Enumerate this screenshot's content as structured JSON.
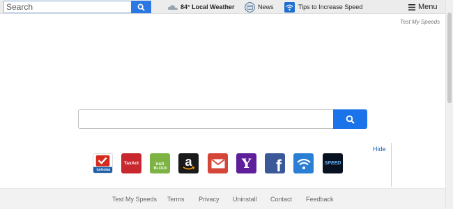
{
  "toolbar": {
    "search_placeholder": "Search",
    "weather_label": "84° Local Weather",
    "news_label": "News",
    "tips_label": "Tips to Increase Speed",
    "menu_label": "Menu"
  },
  "brand": "Test My Speeds",
  "shortcuts": {
    "hide_label": "Hide",
    "tiles": [
      {
        "icon": "turbotax-icon",
        "label": "turbotax",
        "color": "#1a60a8"
      },
      {
        "icon": "taxact-icon",
        "label": "TaxAct",
        "color": "#c8282d"
      },
      {
        "icon": "hr-block-icon",
        "label": "H&R BLOCK",
        "color": "#7cb342"
      },
      {
        "icon": "amazon-icon",
        "label": "a",
        "color": "#1a1a1a"
      },
      {
        "icon": "gmail-icon",
        "label": "",
        "color": "#d44638"
      },
      {
        "icon": "yahoo-icon",
        "label": "Y",
        "color": "#5f1f9a"
      },
      {
        "icon": "facebook-icon",
        "label": "f",
        "color": "#3b5998"
      },
      {
        "icon": "wifi-icon",
        "label": "",
        "color": "#2a7fd4"
      },
      {
        "icon": "speed-icon",
        "label": "SPEED",
        "color": "#08111f"
      }
    ]
  },
  "footer": {
    "links": [
      "Test My Speeds",
      "Terms",
      "Privacy",
      "Uninstall",
      "Contact",
      "Feedback"
    ]
  }
}
